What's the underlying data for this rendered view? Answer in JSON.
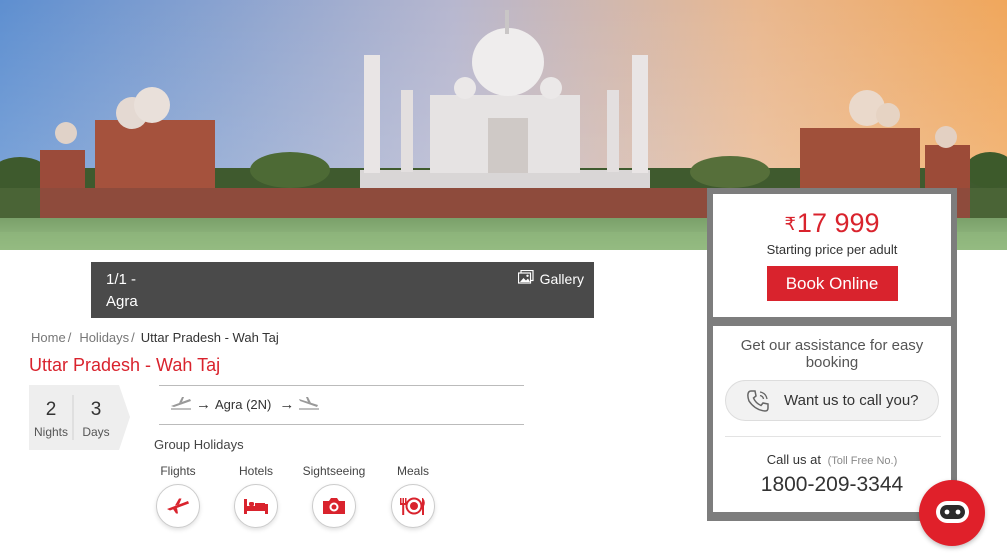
{
  "hero": {
    "alt_subject": ""
  },
  "gallery": {
    "counter": "1/1   -",
    "location": "Agra",
    "link_label": "Gallery"
  },
  "breadcrumb": {
    "items": [
      "Home",
      "Holidays"
    ],
    "separator": "/",
    "current": "Uttar Pradesh - Wah Taj"
  },
  "package": {
    "title": "Uttar Pradesh - Wah Taj",
    "nights_value": "2",
    "nights_label": "Nights",
    "days_value": "3",
    "days_label": "Days",
    "route_stop": "Agra (2N)",
    "route_arrow": "→",
    "group_label": "Group Holidays",
    "inclusions": [
      {
        "label": "Flights",
        "icon": "flight-icon"
      },
      {
        "label": "Hotels",
        "icon": "bed-icon"
      },
      {
        "label": "Sightseeing",
        "icon": "camera-icon"
      },
      {
        "label": "Meals",
        "icon": "meals-icon"
      }
    ]
  },
  "pricing": {
    "currency_symbol": "₹",
    "amount": "17 999",
    "subtitle": "Starting price per adult",
    "book_label": "Book Online"
  },
  "assistance": {
    "title": "Get our assistance for easy booking",
    "call_button_label": "Want us to call you?",
    "call_at_label": "Call us at",
    "toll_free_label": "(Toll Free No.)",
    "phone": "1800-209-3344"
  },
  "colors": {
    "accent": "#d9232d",
    "gallery_bar": "#4a4a4a",
    "panel_frame": "#7d7d7d"
  }
}
